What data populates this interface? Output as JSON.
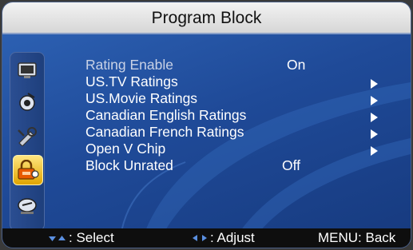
{
  "header": {
    "title": "Program Block"
  },
  "sidebar": {
    "icons": [
      {
        "name": "picture-icon"
      },
      {
        "name": "audio-icon"
      },
      {
        "name": "setup-icon"
      },
      {
        "name": "lock-icon",
        "active": true
      },
      {
        "name": "channel-icon"
      }
    ]
  },
  "menu": {
    "items": [
      {
        "label": "Rating Enable",
        "value": "On",
        "arrow": false
      },
      {
        "label": "US.TV Ratings",
        "value": "",
        "arrow": true
      },
      {
        "label": "US.Movie Ratings",
        "value": "",
        "arrow": true
      },
      {
        "label": "Canadian English Ratings",
        "value": "",
        "arrow": true
      },
      {
        "label": "Canadian French Ratings",
        "value": "",
        "arrow": true
      },
      {
        "label": "Open V Chip",
        "value": "",
        "arrow": true
      },
      {
        "label": "Block Unrated",
        "value": "Off",
        "arrow": false
      }
    ]
  },
  "footer": {
    "select": ": Select",
    "adjust": ": Adjust",
    "back": "MENU: Back"
  },
  "colors": {
    "accent": "#f0c020",
    "background": "#1f4a98"
  }
}
